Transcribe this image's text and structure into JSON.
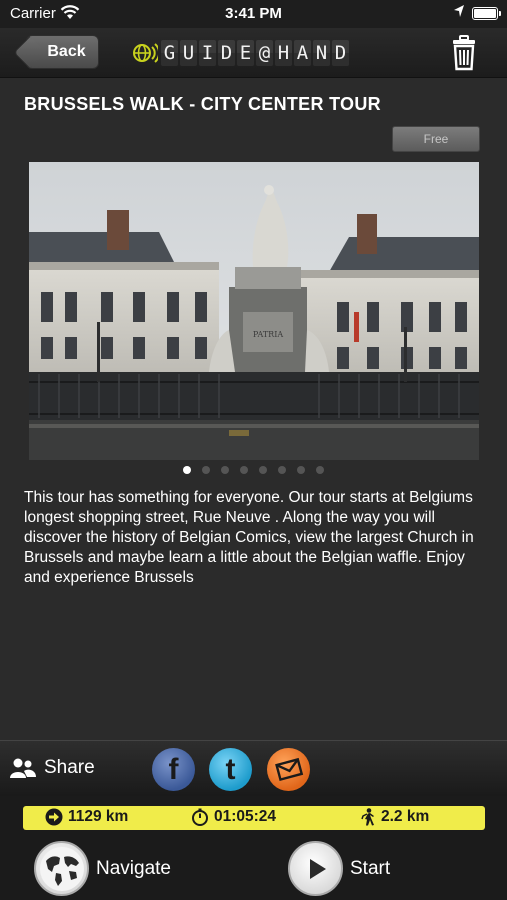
{
  "status_bar": {
    "carrier": "Carrier",
    "time": "3:41 PM"
  },
  "navbar": {
    "back_label": "Back",
    "logo_text": "GUIDE@HAND"
  },
  "tour": {
    "title": "BRUSSELS WALK - CITY CENTER TOUR",
    "badge": "Free",
    "photo_inscription": "PATRIA",
    "gallery": {
      "page_count": 8,
      "current_page": 1
    },
    "description": "This tour has something for everyone.   Our tour starts at Belgiums longest shopping street, Rue Neuve .  Along the way you will discover the history of Belgian Comics, view the largest Church in Brussels and maybe learn a little about the Belgian waffle.  Enjoy and experience Brussels"
  },
  "share": {
    "label": "Share",
    "services": [
      {
        "name": "facebook",
        "icon": "facebook-icon"
      },
      {
        "name": "twitter",
        "icon": "twitter-icon"
      },
      {
        "name": "email",
        "icon": "email-icon"
      }
    ]
  },
  "stats": {
    "distance_to_start": "1129 km",
    "duration": "01:05:24",
    "walk_length": "2.2 km"
  },
  "actions": {
    "navigate_label": "Navigate",
    "start_label": "Start"
  },
  "colors": {
    "stats_bar": "#f0ec4a",
    "background": "#2b2b2b",
    "logo_green": "#c8d21e"
  }
}
